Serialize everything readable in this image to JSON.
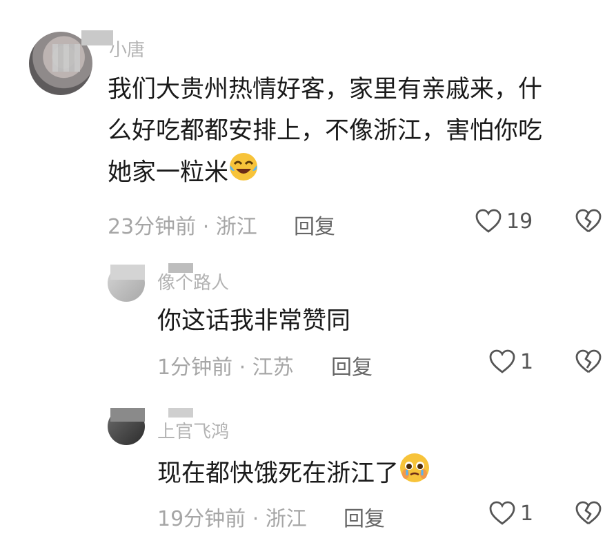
{
  "comments": [
    {
      "username": "小唐",
      "text_lines": [
        "我们大贵州热情好客，家里有亲戚来，什",
        "么好吃都都安排上，不像浙江，害怕你吃",
        "她家一粒米"
      ],
      "emoji": "laughing-crying-emoji",
      "time": "23分钟前",
      "location": "浙江",
      "reply_label": "回复",
      "likes": "19"
    },
    {
      "username": "像个路人",
      "text": "你这话我非常赞同",
      "time": "1分钟前",
      "location": "江苏",
      "reply_label": "回复",
      "likes": "1"
    },
    {
      "username": "上官飞鸿",
      "text": "现在都快饿死在浙江了",
      "emoji": "pleading-face-emoji",
      "time": "19分钟前",
      "location": "浙江",
      "reply_label": "回复",
      "likes": "1"
    }
  ],
  "separator": " · ",
  "colors": {
    "text": "#1a1a1a",
    "meta": "#a6a6a6",
    "username": "#b3b3b3"
  }
}
